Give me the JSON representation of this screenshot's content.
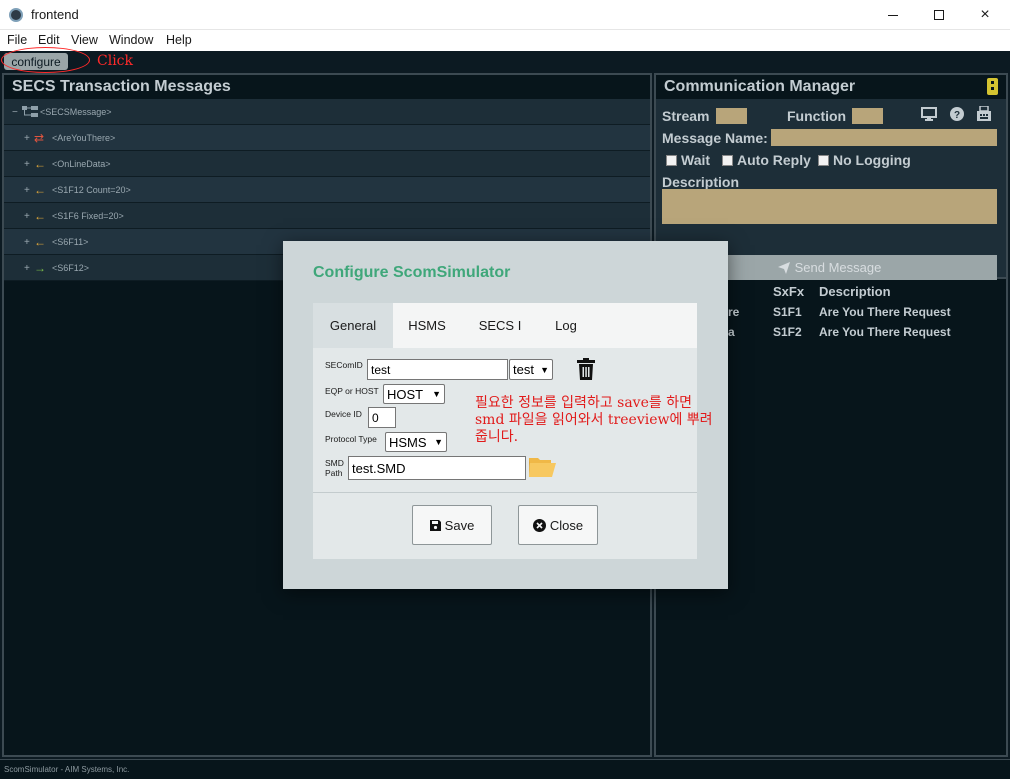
{
  "window": {
    "title": "frontend",
    "controls": {
      "minimize": "minimize",
      "maximize": "maximize",
      "close": "×"
    }
  },
  "menu": [
    "File",
    "Edit",
    "View",
    "Window",
    "Help"
  ],
  "toolbar": {
    "configure_label": "configure",
    "click_annotation": "Click"
  },
  "left_panel": {
    "title": "SECS Transaction Messages",
    "tree": [
      {
        "toggle": "−",
        "icon": "tree-root-icon",
        "label": "<SECSMessage>"
      },
      {
        "toggle": "+",
        "icon": "exchange-icon",
        "label": "<AreYouThere>"
      },
      {
        "toggle": "+",
        "icon": "arrow-left-icon",
        "label": "<OnLineData>"
      },
      {
        "toggle": "+",
        "icon": "arrow-left-icon",
        "label": "<S1F12 Count=20>"
      },
      {
        "toggle": "+",
        "icon": "arrow-left-icon",
        "label": "<S1F6 Fixed=20>"
      },
      {
        "toggle": "+",
        "icon": "arrow-left-icon",
        "label": "<S6F11>"
      },
      {
        "toggle": "+",
        "icon": "arrow-right-icon",
        "label": "<S6F12>"
      }
    ]
  },
  "right_panel": {
    "title": "Communication Manager",
    "stream_label": "Stream",
    "function_label": "Function",
    "message_name_label": "Message Name:",
    "checkboxes": [
      "Wait",
      "Auto Reply",
      "No Logging"
    ],
    "description_label": "Description",
    "send_label": "Send Message",
    "table": {
      "headers": [
        "SxFx",
        "Description"
      ],
      "rows": [
        {
          "name_fragment": "re",
          "sxfx": "S1F1",
          "description": "Are You There Request"
        },
        {
          "name_fragment": "a",
          "sxfx": "S1F2",
          "description": "Are You There Request"
        }
      ]
    }
  },
  "dialog": {
    "title": "Configure ScomSimulator",
    "tabs": [
      "General",
      "HSMS",
      "SECS I",
      "Log"
    ],
    "active_tab": "General",
    "fields": {
      "secom_id_label": "SEComID",
      "secom_id_value": "test",
      "secom_id_select": "test",
      "eqp_host_label": "EQP or HOST",
      "eqp_host_value": "HOST",
      "device_id_label": "Device ID",
      "device_id_value": "0",
      "protocol_label": "Protocol Type",
      "protocol_value": "HSMS",
      "smd_path_label_1": "SMD",
      "smd_path_label_2": "Path",
      "smd_path_value": "test.SMD"
    },
    "annotation": "필요한 정보를 입력하고 save를 하면 smd 파일을 읽어와서 treeview에 뿌려줍니다.",
    "save_label": "Save",
    "close_label": "Close"
  },
  "statusbar": {
    "text": "ScomSimulator - AIM Systems, Inc."
  },
  "colors": {
    "accent_green": "#3fa77a",
    "annotation_red": "#e11b1b",
    "field_tan": "#b8a57a",
    "dark_bg": "#07151b"
  }
}
